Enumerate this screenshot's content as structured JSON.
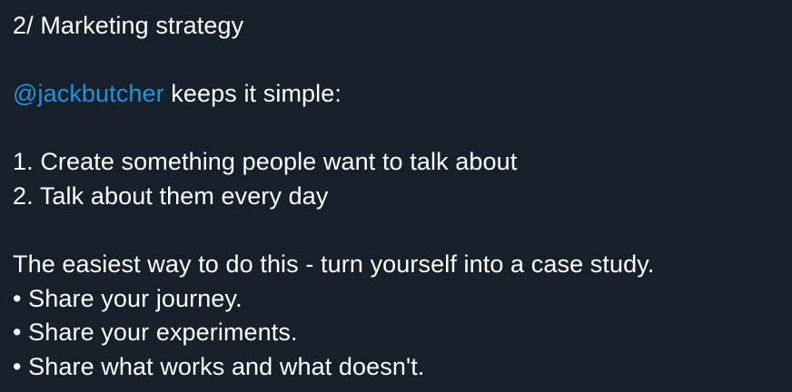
{
  "tweet": {
    "heading": "2/ Marketing strategy",
    "mention": "@jackbutcher",
    "mention_suffix": " keeps it simple:",
    "steps": [
      "1. Create something people want to talk about",
      "2. Talk about them every day"
    ],
    "intro": "The easiest way to do this - turn yourself into a case study.",
    "bullets": [
      "• Share your journey.",
      "• Share your experiments.",
      "• Share what works and what doesn't."
    ]
  },
  "colors": {
    "background": "#15202b",
    "text": "#ffffff",
    "link": "#1b95e0"
  }
}
